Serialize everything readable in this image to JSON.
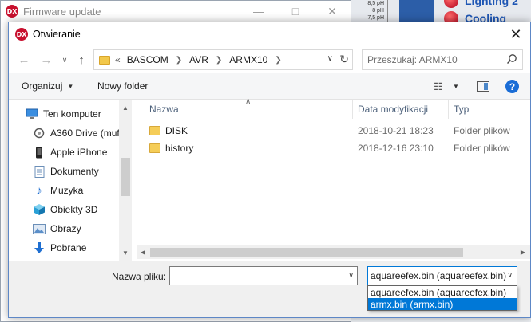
{
  "background_window": {
    "title": "Firmware update",
    "badge": "DX",
    "scale_labels": [
      "8,5 pH",
      "8 pH",
      "7,5 pH"
    ],
    "side_items": [
      "Lighting 2",
      "Cooling"
    ]
  },
  "dialog": {
    "badge": "DX",
    "title": "Otwieranie",
    "close": "✕",
    "address": {
      "prefix": "«",
      "crumbs": [
        "BASCOM",
        "AVR",
        "ARMX10"
      ]
    },
    "search_placeholder": "Przeszukaj: ARMX10",
    "toolbar": {
      "organize": "Organizuj",
      "new_folder": "Nowy folder",
      "help": "?"
    },
    "nav_items": [
      {
        "label": "Ten komputer",
        "icon": "computer-icon"
      },
      {
        "label": "A360 Drive (muf",
        "icon": "cloud-drive-icon"
      },
      {
        "label": "Apple iPhone",
        "icon": "phone-icon"
      },
      {
        "label": "Dokumenty",
        "icon": "documents-icon"
      },
      {
        "label": "Muzyka",
        "icon": "music-icon"
      },
      {
        "label": "Obiekty 3D",
        "icon": "cube-icon"
      },
      {
        "label": "Obrazy",
        "icon": "pictures-icon"
      },
      {
        "label": "Pobrane",
        "icon": "download-icon"
      }
    ],
    "columns": {
      "name": "Nazwa",
      "modified": "Data modyfikacji",
      "type": "Typ"
    },
    "files": [
      {
        "name": "DISK",
        "modified": "2018-10-21 18:23",
        "type": "Folder plików"
      },
      {
        "name": "history",
        "modified": "2018-12-16 23:10",
        "type": "Folder plików"
      }
    ],
    "filename_label": "Nazwa pliku:",
    "filename_value": "",
    "filetype": {
      "selected": "aquareefex.bin (aquareefex.bin)",
      "options": [
        "aquareefex.bin (aquareefex.bin)",
        "armx.bin (armx.bin)"
      ],
      "highlighted_index": 1
    }
  },
  "colors": {
    "accent": "#0078d7",
    "folder": "#f5cd58",
    "badge": "#c8102e"
  }
}
